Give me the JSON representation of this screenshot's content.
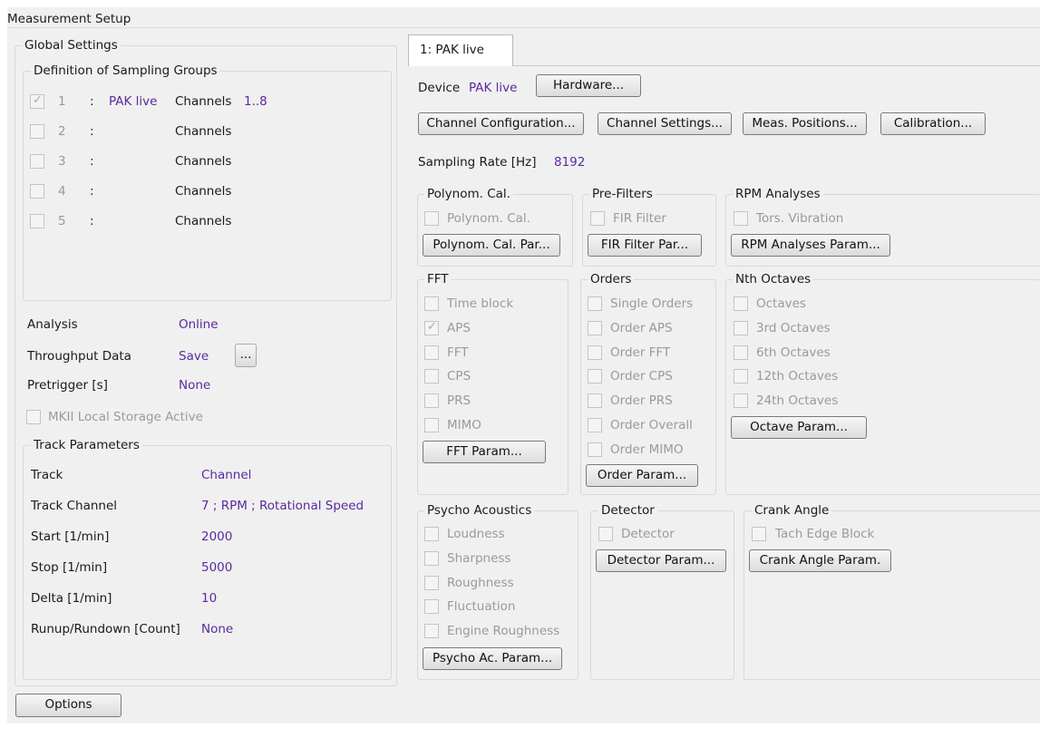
{
  "title": "Measurement Setup",
  "global": {
    "title": "Global Settings",
    "groups_title": "Definition of Sampling Groups",
    "groups": [
      {
        "num": "1",
        "sep": ":",
        "name": "PAK live",
        "ch_label": "Channels",
        "ch_value": "1..8",
        "checked": true
      },
      {
        "num": "2",
        "sep": ":",
        "name": "",
        "ch_label": "Channels",
        "ch_value": "",
        "checked": false
      },
      {
        "num": "3",
        "sep": ":",
        "name": "",
        "ch_label": "Channels",
        "ch_value": "",
        "checked": false
      },
      {
        "num": "4",
        "sep": ":",
        "name": "",
        "ch_label": "Channels",
        "ch_value": "",
        "checked": false
      },
      {
        "num": "5",
        "sep": ":",
        "name": "",
        "ch_label": "Channels",
        "ch_value": "",
        "checked": false
      }
    ],
    "analysis_label": "Analysis",
    "analysis_value": "Online",
    "throughput_label": "Throughput Data",
    "throughput_value": "Save",
    "throughput_button": "...",
    "pretrigger_label": "Pretrigger [s]",
    "pretrigger_value": "None",
    "mkii_label": "MKII Local Storage Active",
    "track_title": "Track Parameters",
    "track": [
      {
        "label": "Track",
        "value": "Channel"
      },
      {
        "label": "Track Channel",
        "value": "7 ; RPM ; Rotational Speed"
      },
      {
        "label": "Start [1/min]",
        "value": "2000"
      },
      {
        "label": "Stop [1/min]",
        "value": "5000"
      },
      {
        "label": "Delta [1/min]",
        "value": "10"
      },
      {
        "label": "Runup/Rundown [Count]",
        "value": "None"
      }
    ]
  },
  "options_button": "Options",
  "tab": {
    "label": "1: PAK live"
  },
  "device": {
    "label": "Device",
    "value": "PAK live",
    "hardware_button": "Hardware..."
  },
  "buttons": {
    "channel_config": "Channel Configuration...",
    "channel_settings": "Channel Settings...",
    "meas_positions": "Meas. Positions...",
    "calibration": "Calibration..."
  },
  "sampling": {
    "label": "Sampling Rate [Hz]",
    "value": "8192"
  },
  "polynom": {
    "title": "Polynom. Cal.",
    "items": [
      "Polynom. Cal."
    ],
    "button": "Polynom. Cal. Par..."
  },
  "prefilters": {
    "title": "Pre-Filters",
    "items": [
      "FIR Filter"
    ],
    "button": "FIR Filter Par..."
  },
  "rpm": {
    "title": "RPM Analyses",
    "items": [
      "Tors. Vibration"
    ],
    "button": "RPM Analyses Param..."
  },
  "fft": {
    "title": "FFT",
    "items": [
      "Time block",
      "APS",
      "FFT",
      "CPS",
      "PRS",
      "MIMO"
    ],
    "checked": [
      false,
      true,
      false,
      false,
      false,
      false
    ],
    "button": "FFT Param..."
  },
  "orders": {
    "title": "Orders",
    "items": [
      "Single Orders",
      "Order APS",
      "Order FFT",
      "Order CPS",
      "Order PRS",
      "Order Overall",
      "Order MIMO"
    ],
    "button": "Order Param..."
  },
  "octaves": {
    "title": "Nth Octaves",
    "items": [
      "Octaves",
      "3rd Octaves",
      "6th Octaves",
      "12th Octaves",
      "24th Octaves"
    ],
    "button": "Octave Param..."
  },
  "psycho": {
    "title": "Psycho Acoustics",
    "items": [
      "Loudness",
      "Sharpness",
      "Roughness",
      "Fluctuation",
      "Engine Roughness"
    ],
    "button": "Psycho Ac. Param..."
  },
  "detector": {
    "title": "Detector",
    "items": [
      "Detector"
    ],
    "button": "Detector Param..."
  },
  "crank": {
    "title": "Crank Angle",
    "items": [
      "Tach Edge Block"
    ],
    "button": "Crank Angle Param."
  }
}
